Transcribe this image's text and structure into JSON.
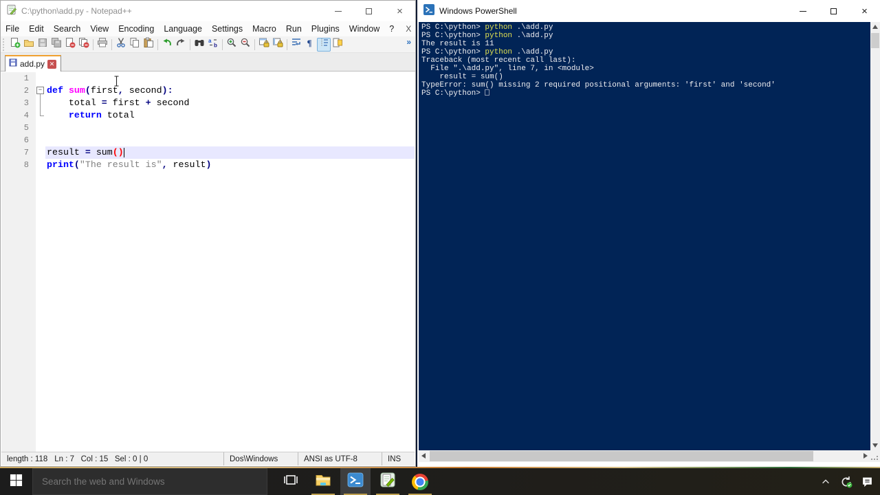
{
  "notepadpp": {
    "window_title": "C:\\python\\add.py - Notepad++",
    "menu_items": [
      "File",
      "Edit",
      "Search",
      "View",
      "Encoding",
      "Language",
      "Settings",
      "Macro",
      "Run",
      "Plugins",
      "Window",
      "?"
    ],
    "menu_close_label": "X",
    "toolbar_icons": [
      {
        "name": "new-file-icon"
      },
      {
        "name": "open-file-icon"
      },
      {
        "name": "save-icon",
        "disabled": true
      },
      {
        "name": "save-all-icon",
        "disabled": true
      },
      {
        "name": "close-file-icon"
      },
      {
        "name": "close-all-files-icon"
      },
      {
        "name": "print-icon",
        "sep": true
      },
      {
        "name": "cut-icon",
        "sep": true
      },
      {
        "name": "copy-icon"
      },
      {
        "name": "paste-icon"
      },
      {
        "name": "undo-icon",
        "sep": true
      },
      {
        "name": "redo-icon"
      },
      {
        "name": "find-icon",
        "sep": true
      },
      {
        "name": "replace-icon"
      },
      {
        "name": "zoom-in-icon",
        "sep": true
      },
      {
        "name": "zoom-out-icon"
      },
      {
        "name": "sync-vertical-icon",
        "sep": true
      },
      {
        "name": "sync-horizontal-icon"
      },
      {
        "name": "word-wrap-icon",
        "sep": true
      },
      {
        "name": "show-all-chars-icon"
      },
      {
        "name": "indent-guide-icon",
        "active": true
      },
      {
        "name": "doc-map-icon"
      }
    ],
    "toolbar_overflow_label": "»",
    "tab": {
      "label": "add.py"
    },
    "editor": {
      "lines": [
        {
          "n": 1,
          "tokens": []
        },
        {
          "n": 2,
          "fold": "open",
          "tokens": [
            {
              "t": "def",
              "c": "kw"
            },
            {
              "t": " ",
              "c": "pl"
            },
            {
              "t": "sum",
              "c": "fn"
            },
            {
              "t": "(",
              "c": "op"
            },
            {
              "t": "first",
              "c": "pl"
            },
            {
              "t": ",",
              "c": "op"
            },
            {
              "t": " second",
              "c": "pl"
            },
            {
              "t": ")",
              "c": "op"
            },
            {
              "t": ":",
              "c": "op"
            }
          ]
        },
        {
          "n": 3,
          "tokens": [
            {
              "t": "    total ",
              "c": "pl"
            },
            {
              "t": "=",
              "c": "op"
            },
            {
              "t": " first ",
              "c": "pl"
            },
            {
              "t": "+",
              "c": "op"
            },
            {
              "t": " second",
              "c": "pl"
            }
          ]
        },
        {
          "n": 4,
          "tokens": [
            {
              "t": "    ",
              "c": "pl"
            },
            {
              "t": "return",
              "c": "kw"
            },
            {
              "t": " total",
              "c": "pl"
            }
          ]
        },
        {
          "n": 5,
          "tokens": []
        },
        {
          "n": 6,
          "tokens": []
        },
        {
          "n": 7,
          "current": true,
          "tokens": [
            {
              "t": "result ",
              "c": "pl"
            },
            {
              "t": "=",
              "c": "op"
            },
            {
              "t": " sum",
              "c": "pl"
            },
            {
              "t": "()",
              "c": "match"
            }
          ]
        },
        {
          "n": 8,
          "tokens": [
            {
              "t": "print",
              "c": "kw"
            },
            {
              "t": "(",
              "c": "op"
            },
            {
              "t": "\"The result is\"",
              "c": "str"
            },
            {
              "t": ",",
              "c": "op"
            },
            {
              "t": " result",
              "c": "pl"
            },
            {
              "t": ")",
              "c": "op"
            }
          ]
        }
      ]
    },
    "syntax_colors": {
      "keyword": "#0000ff",
      "function": "#ff00ff",
      "operator": "#000080",
      "string": "#808080",
      "plain": "#000000",
      "brace_match": "#ff0000",
      "current_line_bg": "#e8e8ff"
    },
    "statusbar": {
      "doc_length": "length : 118",
      "caret_info": "Ln : 7   Col : 15   Sel : 0 | 0",
      "eol_format": "Dos\\Windows",
      "encoding": "ANSI as UTF-8",
      "typing_mode": "INS"
    }
  },
  "powershell": {
    "window_title": "Windows PowerShell",
    "colors": {
      "background": "#012456",
      "text": "#eeedf0",
      "command": "#e0e051"
    },
    "lines": [
      [
        {
          "t": "PS C:\\python> ",
          "c": "pl"
        },
        {
          "t": "python",
          "c": "cmd"
        },
        {
          "t": " .\\add.py",
          "c": "pl"
        }
      ],
      [
        {
          "t": "PS C:\\python> ",
          "c": "pl"
        },
        {
          "t": "python",
          "c": "cmd"
        },
        {
          "t": " .\\add.py",
          "c": "pl"
        }
      ],
      [
        {
          "t": "The result is 11",
          "c": "pl"
        }
      ],
      [
        {
          "t": "PS C:\\python> ",
          "c": "pl"
        },
        {
          "t": "python",
          "c": "cmd"
        },
        {
          "t": " .\\add.py",
          "c": "pl"
        }
      ],
      [
        {
          "t": "Traceback (most recent call last):",
          "c": "pl"
        }
      ],
      [
        {
          "t": "  File \".\\add.py\", line 7, in <module>",
          "c": "pl"
        }
      ],
      [
        {
          "t": "    result = sum()",
          "c": "pl"
        }
      ],
      [
        {
          "t": "TypeError: sum() missing 2 required positional arguments: 'first' and 'second'",
          "c": "pl"
        }
      ],
      [
        {
          "t": "PS C:\\python> ",
          "c": "pl"
        },
        {
          "t": "",
          "c": "cursor"
        }
      ]
    ]
  },
  "taskbar": {
    "search_placeholder": "Search the web and Windows",
    "app_buttons": [
      "task-view",
      "file-explorer",
      "powershell",
      "notepadpp",
      "chrome"
    ],
    "active_app": "powershell",
    "open_apps_with_indicator": [
      "file-explorer",
      "powershell",
      "notepadpp",
      "chrome"
    ],
    "tray_icons": [
      "chevron-up-icon",
      "sync-status-icon",
      "action-center-icon"
    ],
    "icons": [
      "windows-logo-icon",
      "task-view-icon",
      "file-explorer-icon",
      "powershell-icon",
      "notepadpp-icon",
      "chrome-icon"
    ]
  }
}
